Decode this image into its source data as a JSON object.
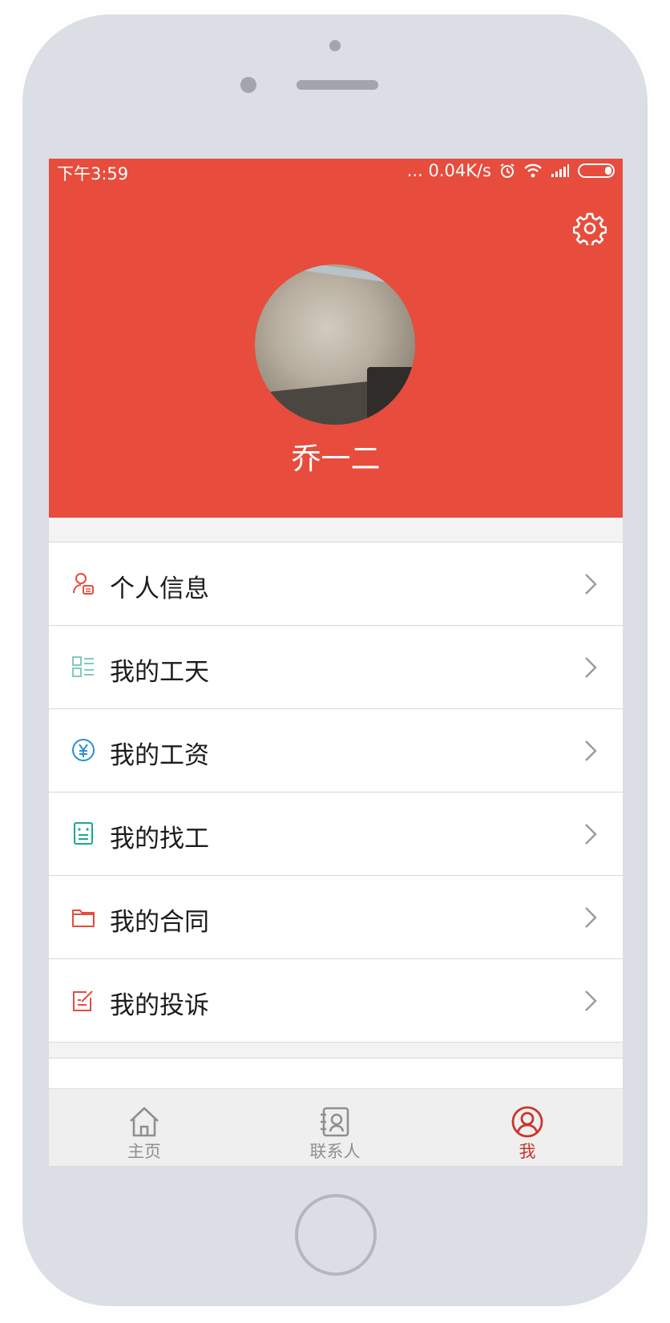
{
  "status_bar": {
    "time": "下午3:59",
    "network_speed": "... 0.04K/s"
  },
  "profile": {
    "username": "乔一二"
  },
  "menu": [
    {
      "label": "个人信息",
      "icon": "personal-info-icon",
      "color": "#e74c3c"
    },
    {
      "label": "我的工天",
      "icon": "work-days-icon",
      "color": "#7ecbc0"
    },
    {
      "label": "我的工资",
      "icon": "salary-icon",
      "color": "#2a8fd6"
    },
    {
      "label": "我的找工",
      "icon": "find-work-icon",
      "color": "#1ca88a"
    },
    {
      "label": "我的合同",
      "icon": "contract-icon",
      "color": "#e74c3c"
    },
    {
      "label": "我的投诉",
      "icon": "complaint-icon",
      "color": "#e74c3c"
    }
  ],
  "tabbar": {
    "home": "主页",
    "contacts": "联系人",
    "me": "我"
  },
  "colors": {
    "header": "#e74c3c",
    "active_tab": "#c8362b"
  }
}
